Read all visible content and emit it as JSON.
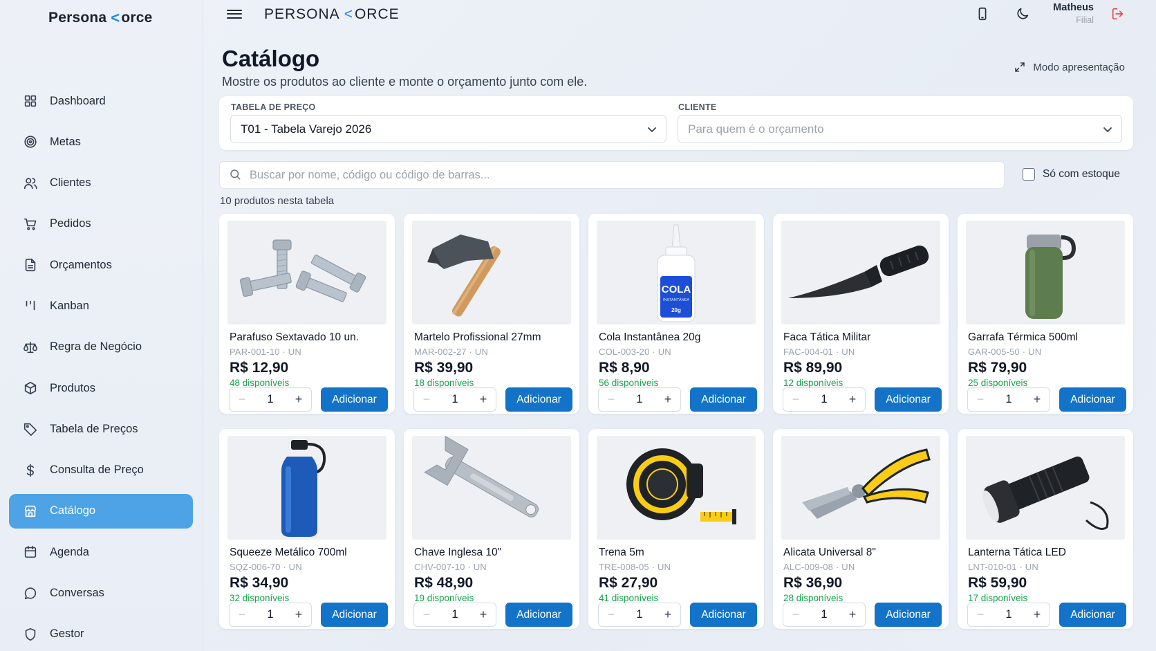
{
  "brand": {
    "name_prefix": "Persona",
    "f_mark": "<",
    "name_suffix": "orce",
    "top_prefix": "PERSONA",
    "top_suffix": "ORCE"
  },
  "sidebar": {
    "items": [
      {
        "label": "Dashboard",
        "icon": "grid-icon"
      },
      {
        "label": "Metas",
        "icon": "target-icon"
      },
      {
        "label": "Clientes",
        "icon": "users-icon"
      },
      {
        "label": "Pedidos",
        "icon": "cart-icon"
      },
      {
        "label": "Orçamentos",
        "icon": "document-icon"
      },
      {
        "label": "Kanban",
        "icon": "kanban-icon"
      },
      {
        "label": "Regra de Negócio",
        "icon": "scale-icon"
      },
      {
        "label": "Produtos",
        "icon": "box-icon"
      },
      {
        "label": "Tabela de Preços",
        "icon": "tag-icon"
      },
      {
        "label": "Consulta de Preço",
        "icon": "dollar-icon"
      },
      {
        "label": "Catálogo",
        "icon": "store-icon",
        "active": true
      },
      {
        "label": "Agenda",
        "icon": "calendar-icon"
      },
      {
        "label": "Conversas",
        "icon": "chat-icon"
      },
      {
        "label": "Gestor",
        "icon": "shield-icon"
      }
    ]
  },
  "user": {
    "name": "Matheus",
    "role": "Filial"
  },
  "page": {
    "title": "Catálogo",
    "subtitle": "Mostre os produtos ao cliente e monte o orçamento junto com ele.",
    "present_label": "Modo apresentação"
  },
  "filters": {
    "price_table_label": "TABELA DE PREÇO",
    "price_table_value": "T01 - Tabela Varejo 2026",
    "client_label": "CLIENTE",
    "client_placeholder": "Para quem é o orçamento"
  },
  "search": {
    "placeholder": "Buscar por nome, código ou código de barras..."
  },
  "stock_only_label": "Só com estoque",
  "products_count": "10 produtos nesta tabela",
  "add_label": "Adicionar",
  "products": [
    {
      "name": "Parafuso Sextavado 10 un.",
      "code": "PAR-001-10 · UN",
      "price": "R$ 12,90",
      "stock": "48 disponíveis",
      "qty": "1",
      "image": "bolts"
    },
    {
      "name": "Martelo Profissional 27mm",
      "code": "MAR-002-27 · UN",
      "price": "R$ 39,90",
      "stock": "18 disponíveis",
      "qty": "1",
      "image": "hammer"
    },
    {
      "name": "Cola Instantânea 20g",
      "code": "COL-003-20 · UN",
      "price": "R$ 8,90",
      "stock": "56 disponíveis",
      "qty": "1",
      "image": "glue"
    },
    {
      "name": "Faca Tática Militar",
      "code": "FAC-004-01 · UN",
      "price": "R$ 89,90",
      "stock": "12 disponíveis",
      "qty": "1",
      "image": "knife"
    },
    {
      "name": "Garrafa Térmica 500ml",
      "code": "GAR-005-50 · UN",
      "price": "R$ 79,90",
      "stock": "25 disponíveis",
      "qty": "1",
      "image": "thermos"
    },
    {
      "name": "Squeeze Metálico 700ml",
      "code": "SQZ-006-70 · UN",
      "price": "R$ 34,90",
      "stock": "32 disponíveis",
      "qty": "1",
      "image": "squeeze"
    },
    {
      "name": "Chave Inglesa 10\"",
      "code": "CHV-007-10 · UN",
      "price": "R$ 48,90",
      "stock": "19 disponíveis",
      "qty": "1",
      "image": "wrench"
    },
    {
      "name": "Trena 5m",
      "code": "TRE-008-05 · UN",
      "price": "R$ 27,90",
      "stock": "41 disponíveis",
      "qty": "1",
      "image": "tape"
    },
    {
      "name": "Alicata Universal 8\"",
      "code": "ALC-009-08 · UN",
      "price": "R$ 36,90",
      "stock": "28 disponíveis",
      "qty": "1",
      "image": "pliers"
    },
    {
      "name": "Lanterna Tática LED",
      "code": "LNT-010-01 · UN",
      "price": "R$ 59,90",
      "stock": "17 disponíveis",
      "qty": "1",
      "image": "flashlight"
    }
  ],
  "glue_label": {
    "main": "COLA",
    "sub": "INSTANTÂNEA",
    "weight": "20g"
  },
  "colors": {
    "accent": "#1273c8",
    "active_nav": "#4da3e6",
    "stock_green": "#16a34a",
    "logout_red": "#ef4444",
    "brand_blue": "#1e88e5"
  }
}
